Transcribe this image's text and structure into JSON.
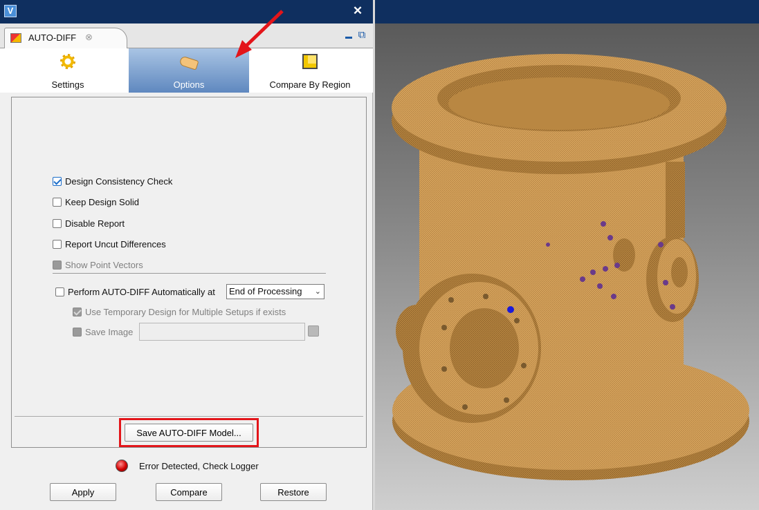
{
  "window": {
    "app_icon": "V",
    "close_symbol": "✕"
  },
  "tab": {
    "label": "AUTO-DIFF",
    "close_symbol": "⊗",
    "float_symbol": "⧉"
  },
  "toolbar": {
    "items": [
      {
        "label": "Settings",
        "icon": "gear-icon"
      },
      {
        "label": "Options",
        "icon": "hand-icon",
        "active": true
      },
      {
        "label": "Compare By Region",
        "icon": "cube-icon"
      }
    ]
  },
  "options": {
    "design_consistency_check": {
      "label": "Design Consistency Check",
      "checked": true
    },
    "keep_design_solid": {
      "label": "Keep Design Solid",
      "checked": false
    },
    "disable_report": {
      "label": "Disable Report",
      "checked": false
    },
    "report_uncut_differences": {
      "label": "Report Uncut Differences",
      "checked": false
    },
    "show_point_vectors": {
      "label": "Show Point Vectors",
      "checked": false,
      "enabled": false
    },
    "perform_auto_diff": {
      "label": "Perform AUTO-DIFF Automatically at",
      "checked": false
    },
    "perform_when": {
      "value": "End of Processing",
      "chevron": "⌄"
    },
    "use_temporary_design": {
      "label": "Use Temporary Design for Multiple Setups if exists",
      "checked": true,
      "enabled": false
    },
    "save_image": {
      "label": "Save Image",
      "checked": false,
      "enabled": false,
      "path": ""
    }
  },
  "save_model_button": "Save AUTO-DIFF Model...",
  "status": {
    "text": "Error Detected, Check Logger",
    "color": "#d10000"
  },
  "buttons": {
    "apply": "Apply",
    "compare": "Compare",
    "restore": "Restore"
  },
  "colors": {
    "titlebar": "#0f2f5f",
    "model": "#d9a65f",
    "highlight": "#e3151a"
  }
}
